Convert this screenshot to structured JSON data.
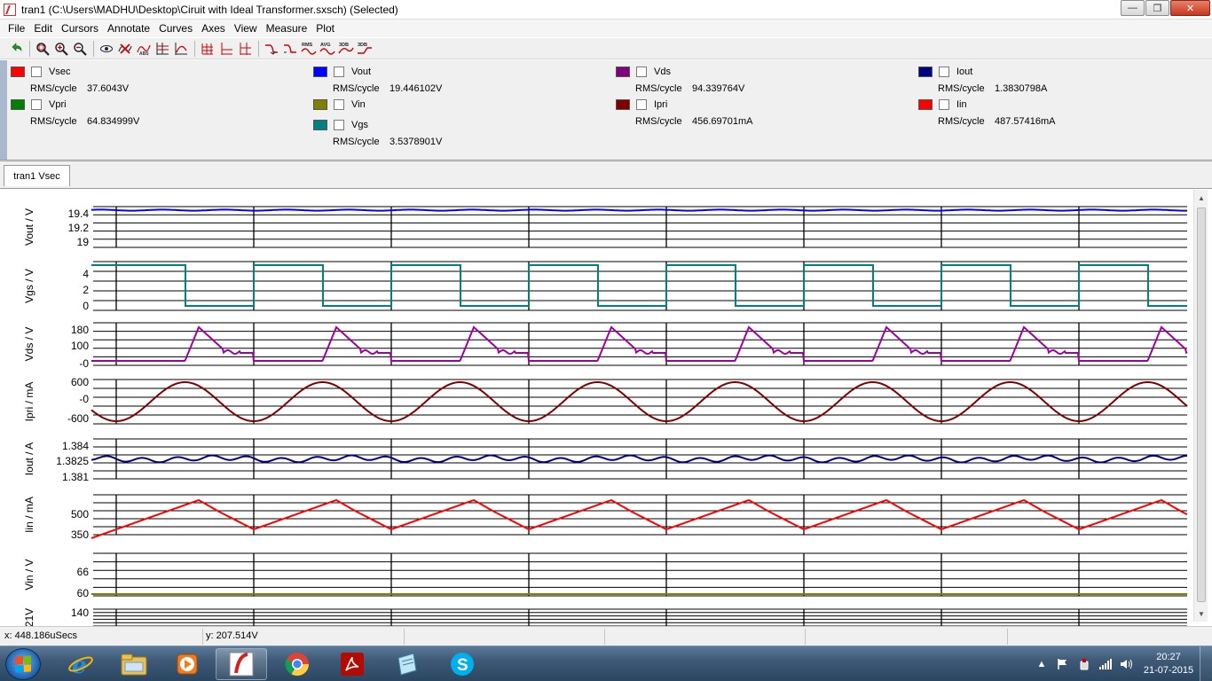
{
  "window": {
    "title": "tran1 (C:\\Users\\MADHU\\Desktop\\Ciruit with Ideal Transformer.sxsch) (Selected)",
    "controls": {
      "minimize": "—",
      "maximize": "❐",
      "close": "✕"
    }
  },
  "menu": [
    "File",
    "Edit",
    "Cursors",
    "Annotate",
    "Curves",
    "Axes",
    "View",
    "Measure",
    "Plot"
  ],
  "toolbar": {
    "labels": {
      "rms": "RMS",
      "avg": "AVG",
      "db1": "3DB",
      "db2": "3DB"
    },
    "icons": [
      "undo-icon",
      "zoom-fit-icon",
      "zoom-in-icon",
      "zoom-out-icon",
      "eye-icon",
      "delete-curve-icon",
      "abs-icon",
      "fit-grid-icon",
      "grid-icon",
      "axes-icon",
      "separate-axes-icon",
      "rise-icon",
      "fall-icon",
      "rms-icon",
      "avg-icon",
      "3db-up-icon",
      "3db-down-icon"
    ]
  },
  "legend": [
    {
      "name": "Vsec",
      "color": "#ff0000",
      "rms_label": "RMS/cycle",
      "rms_value": "37.6043V"
    },
    {
      "name": "Vpri",
      "color": "#008000",
      "rms_label": "RMS/cycle",
      "rms_value": "64.834999V"
    },
    {
      "name": "Vout",
      "color": "#0000ff",
      "rms_label": "RMS/cycle",
      "rms_value": "19.446102V"
    },
    {
      "name": "Vin",
      "color": "#808000",
      "rms_label": "",
      "rms_value": ""
    },
    {
      "name": "Vgs",
      "color": "#008080",
      "rms_label": "RMS/cycle",
      "rms_value": "3.5378901V"
    },
    {
      "name": "Vds",
      "color": "#800080",
      "rms_label": "RMS/cycle",
      "rms_value": "94.339764V"
    },
    {
      "name": "Ipri",
      "color": "#800000",
      "rms_label": "RMS/cycle",
      "rms_value": "456.69701mA"
    },
    {
      "name": "Iout",
      "color": "#000080",
      "rms_label": "RMS/cycle",
      "rms_value": "1.3830798A"
    },
    {
      "name": "Iin",
      "color": "#ff0000",
      "rms_label": "RMS/cycle",
      "rms_value": "487.57416mA"
    }
  ],
  "tab": {
    "label": "tran1 Vsec"
  },
  "plots": [
    {
      "id": "vout",
      "ylabel": "Vout / V",
      "color": "#0000ff",
      "ticks": [
        "19.4",
        "19.2",
        "19"
      ]
    },
    {
      "id": "vgs",
      "ylabel": "Vgs / V",
      "color": "#008080",
      "ticks": [
        "4",
        "2",
        "0"
      ]
    },
    {
      "id": "vds",
      "ylabel": "Vds / V",
      "color": "#a000a0",
      "ticks": [
        "180",
        "100",
        "-0"
      ]
    },
    {
      "id": "ipri",
      "ylabel": "Ipri / mA",
      "color": "#800000",
      "ticks": [
        "600",
        "-0",
        "-600"
      ]
    },
    {
      "id": "iout",
      "ylabel": "Iout / A",
      "color": "#000080",
      "ticks": [
        "1.384",
        "1.3825",
        "1.381"
      ]
    },
    {
      "id": "iin",
      "ylabel": "Iin / mA",
      "color": "#ff0000",
      "ticks": [
        "500",
        "350"
      ]
    },
    {
      "id": "vin",
      "ylabel": "Vin / V",
      "color": "#808000",
      "ticks": [
        "66",
        "60"
      ]
    },
    {
      "id": "partial",
      "ylabel": "21V",
      "color": "#000000",
      "ticks": [
        "140"
      ]
    }
  ],
  "status": {
    "x": "x: 448.186uSecs",
    "y": "y: 207.514V"
  },
  "taskbar": {
    "apps": [
      "Internet Explorer",
      "Windows Explorer",
      "Windows Media Player",
      "SIMetrix",
      "Google Chrome",
      "Adobe Reader",
      "Notepad",
      "Skype"
    ],
    "time": "20:27",
    "date": "21-07-2015"
  }
}
